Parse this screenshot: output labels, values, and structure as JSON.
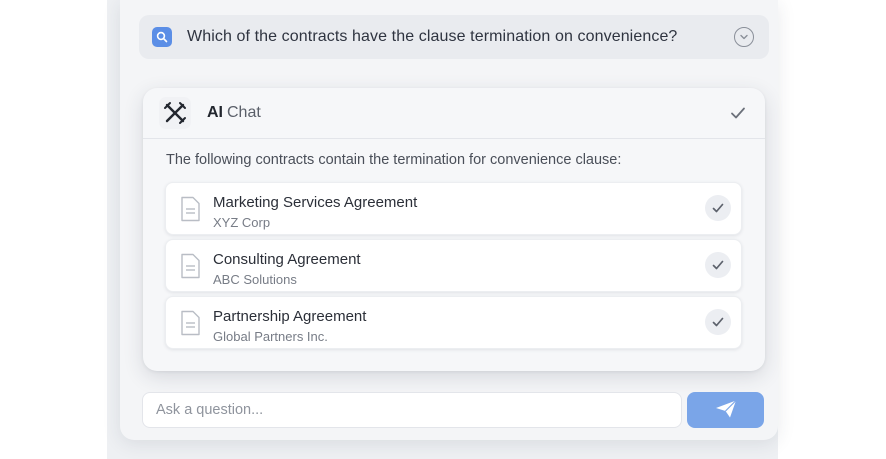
{
  "query": {
    "text": "Which of the contracts have the clause termination on convenience?",
    "icon": "search-icon",
    "expand_icon": "chevron-down-icon"
  },
  "chat": {
    "title_bold": "AI",
    "title_light": "Chat",
    "logo_icon": "crossed-tools-icon",
    "status_icon": "check-icon",
    "intro": "The following contracts contain the termination for convenience clause:",
    "contracts": [
      {
        "title": "Marketing Services Agreement",
        "party": "XYZ Corp",
        "icon": "document-icon",
        "status_icon": "check-icon"
      },
      {
        "title": "Consulting Agreement",
        "party": "ABC Solutions",
        "icon": "document-icon",
        "status_icon": "check-icon"
      },
      {
        "title": "Partnership Agreement",
        "party": "Global Partners Inc.",
        "icon": "document-icon",
        "status_icon": "check-icon"
      }
    ]
  },
  "composer": {
    "placeholder": "Ask a question...",
    "value": "",
    "send_icon": "paper-plane-icon"
  },
  "colors": {
    "accent": "#5b8ee6",
    "send_button": "#7aa5e8",
    "panel_background": "#f6f7f9",
    "page_background": "#eef0f3"
  }
}
